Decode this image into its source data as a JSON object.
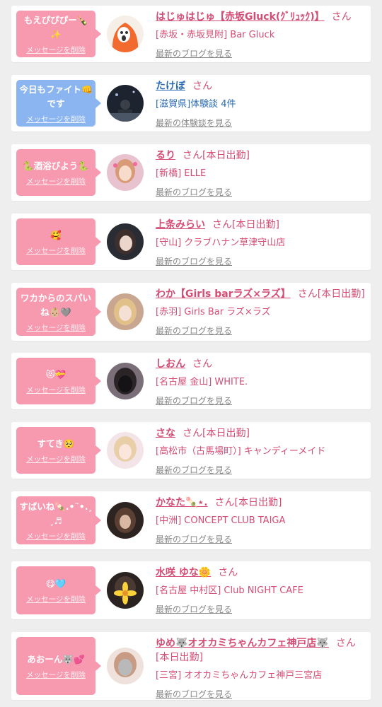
{
  "items": [
    {
      "message": "もえぴぴぴー🍾✨",
      "delete_label": "メッセージを削除",
      "name": "はじゅはじゅ【赤坂Gluck(ｸﾞﾘｭｯｸ)】",
      "honorific": "さん",
      "status": "",
      "shop": "[赤坂・赤坂見附] Bar Gluck",
      "more": "最新のブログを見る",
      "bubble": "pink",
      "avatar": "avatar-orange-mascot"
    },
    {
      "message": "今日もファイト👊です",
      "delete_label": "メッセージを削除",
      "name": "たけぼ",
      "honorific": "さん",
      "status": "",
      "shop": "[滋賀県]体験談 4件",
      "more": "最新の体験談を見る",
      "bubble": "blue",
      "avatar": "avatar-night-photo"
    },
    {
      "message": "🐍酒浴びよう🐍",
      "delete_label": "メッセージを削除",
      "name": "るり",
      "honorific": "さん",
      "status": "[本日出勤]",
      "shop": "[新橋] ELLE",
      "more": "最新のブログを見る",
      "bubble": "pink",
      "avatar": "avatar-photo"
    },
    {
      "message": "🥰",
      "delete_label": "メッセージを削除",
      "name": "上条みらい",
      "honorific": "さん",
      "status": "[本日出勤]",
      "shop": "[守山] クラブハナン草津守山店",
      "more": "最新のブログを見る",
      "bubble": "pink",
      "avatar": "avatar-photo"
    },
    {
      "message": "ワカからのスパいね👶🏼🩶",
      "delete_label": "メッセージを削除",
      "name": "わか【Girls barラズ×ラズ】",
      "honorific": "さん",
      "status": "[本日出勤]",
      "shop": "[赤羽] Girls Bar ラズ×ラズ",
      "more": "最新のブログを見る",
      "bubble": "pink",
      "avatar": "avatar-photo"
    },
    {
      "message": "😻💝",
      "delete_label": "メッセージを削除",
      "name": "しおん",
      "honorific": "さん",
      "status": "",
      "shop": "[名古屋 金山] WHITE.",
      "more": "最新のブログを見る",
      "bubble": "pink",
      "avatar": "avatar-photo"
    },
    {
      "message": "すてき🥺",
      "delete_label": "メッセージを削除",
      "name": "さな",
      "honorific": "さん",
      "status": "[本日出勤]",
      "shop": "[高松市（古馬場町）] キャンディーメイド",
      "more": "最新のブログを見る",
      "bubble": "pink",
      "avatar": "avatar-photo"
    },
    {
      "message": "すばいね🍡.•¨•.¸¸♬",
      "delete_label": "メッセージを削除",
      "name": "かなた🍡⋆.",
      "honorific": "さん",
      "status": "[本日出勤]",
      "shop": "[中洲] CONCEPT CLUB TAIGA",
      "more": "最新のブログを見る",
      "bubble": "pink",
      "avatar": "avatar-photo"
    },
    {
      "message": "😋🩵",
      "delete_label": "メッセージを削除",
      "name": "水咲 ゆな🌼",
      "honorific": "さん",
      "status": "",
      "shop": "[名古屋 中村区] Club NIGHT CAFE",
      "more": "最新のブログを見る",
      "bubble": "pink",
      "avatar": "avatar-flower"
    },
    {
      "message": "あおーん🐺💕",
      "delete_label": "メッセージを削除",
      "name": "ゆめ🐺オオカミちゃんカフェ神戸店🐺",
      "honorific": "さん",
      "status": "[本日出勤]",
      "shop": "[三宮] オオカミちゃんカフェ神戸三宮店",
      "more": "最新のブログを見る",
      "bubble": "pink",
      "avatar": "avatar-photo"
    }
  ],
  "colors": {
    "accent": "#d34d74",
    "pink_bubble": "#f79ab0",
    "blue_bubble": "#8bb5f1",
    "link_blue": "#2b6bb5",
    "muted": "#888888",
    "background": "#eeeeee"
  }
}
